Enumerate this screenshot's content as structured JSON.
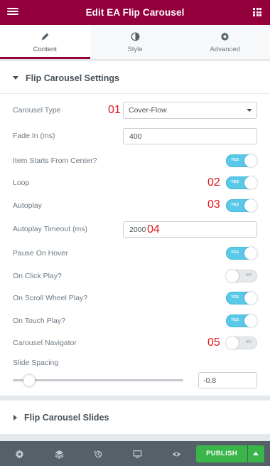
{
  "header": {
    "title": "Edit EA Flip Carousel",
    "menu_icon": "hamburger-icon",
    "apps_icon": "grid-icon",
    "background": "#93003c"
  },
  "tabs": [
    {
      "label": "Content",
      "icon": "pencil-icon",
      "active": true
    },
    {
      "label": "Style",
      "icon": "contrast-icon",
      "active": false
    },
    {
      "label": "Advanced",
      "icon": "gear-icon",
      "active": false
    }
  ],
  "section_settings": {
    "title": "Flip Carousel Settings",
    "expanded": true
  },
  "settings": {
    "carousel_type": {
      "label": "Carousel Type",
      "value": "Cover-Flow",
      "marker": "01"
    },
    "fade_in": {
      "label": "Fade In (ms)",
      "value": "400"
    },
    "item_starts_center": {
      "label": "Item Starts From Center?",
      "state": "on",
      "toggle_text": "YES"
    },
    "loop": {
      "label": "Loop",
      "state": "on",
      "toggle_text": "YES",
      "marker": "02"
    },
    "autoplay": {
      "label": "Autoplay",
      "state": "on",
      "toggle_text": "YES",
      "marker": "03"
    },
    "autoplay_timeout": {
      "label": "Autoplay Timeout (ms)",
      "value": "2000",
      "marker": "04"
    },
    "pause_on_hover": {
      "label": "Pause On Hover",
      "state": "on",
      "toggle_text": "YES"
    },
    "on_click_play": {
      "label": "On Click Play?",
      "state": "off",
      "toggle_text": "NO"
    },
    "on_scroll_wheel_play": {
      "label": "On Scroll Wheel Play?",
      "state": "on",
      "toggle_text": "YES"
    },
    "on_touch_play": {
      "label": "On Touch Play?",
      "state": "on",
      "toggle_text": "YES"
    },
    "carousel_navigator": {
      "label": "Carousel Navigator",
      "state": "off",
      "toggle_text": "NO",
      "marker": "05"
    },
    "slide_spacing": {
      "label": "Slide Spacing",
      "value": "-0.8"
    }
  },
  "section_slides": {
    "title": "Flip Carousel Slides",
    "expanded": false
  },
  "footer": {
    "icons": [
      "gear-icon",
      "layers-icon",
      "history-icon",
      "desktop-icon",
      "eye-icon"
    ],
    "publish_label": "PUBLISH",
    "publish_color": "#39b54a"
  },
  "colors": {
    "toggle_on": "#5ac8e7",
    "marker": "#e0181d"
  }
}
